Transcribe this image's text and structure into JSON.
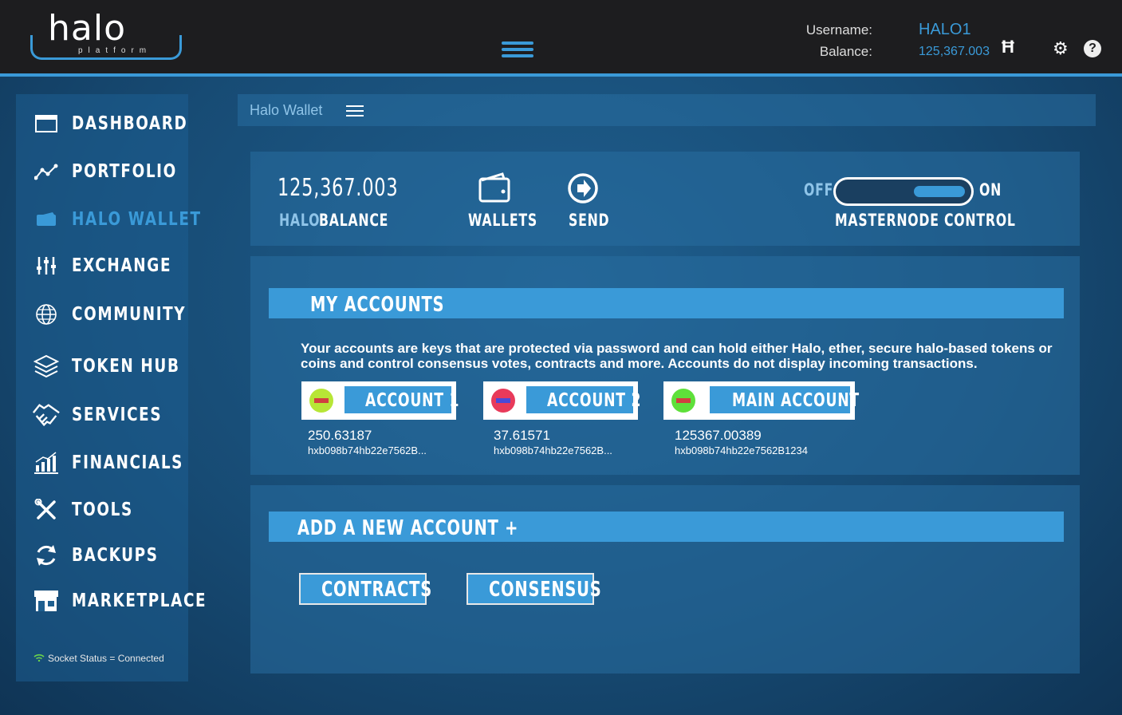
{
  "header": {
    "logo_word": "halo",
    "logo_sub": "platform",
    "username_label": "Username:",
    "balance_label": "Balance:",
    "username": "HALO1",
    "balance": "125,367.003",
    "currency_symbol": "Ħ"
  },
  "sidebar": {
    "items": [
      {
        "label": "DASHBOARD",
        "icon": "browser-window-icon"
      },
      {
        "label": "PORTFOLIO",
        "icon": "line-graph-icon"
      },
      {
        "label": "HALO WALLET",
        "icon": "wallet-icon"
      },
      {
        "label": "EXCHANGE",
        "icon": "sliders-icon"
      },
      {
        "label": "COMMUNITY",
        "icon": "globe-icon"
      },
      {
        "label": "TOKEN HUB",
        "icon": "layers-icon"
      },
      {
        "label": "SERVICES",
        "icon": "handshake-icon"
      },
      {
        "label": "FINANCIALS",
        "icon": "bar-chart-icon"
      },
      {
        "label": "TOOLS",
        "icon": "tools-icon"
      },
      {
        "label": "BACKUPS",
        "icon": "refresh-icon"
      },
      {
        "label": "MARKETPLACE",
        "icon": "store-icon"
      }
    ],
    "active": "HALO WALLET",
    "socket_status": "Socket Status = Connected"
  },
  "page": {
    "title": "Halo Wallet"
  },
  "summary": {
    "balance_value": "125,367.003",
    "currency": "HALO",
    "balance_label": "BALANCE",
    "wallets_label": "WALLETS",
    "send_label": "SEND",
    "off_label": "OFF",
    "on_label": "ON",
    "masternode_label": "MASTERNODE CONTROL",
    "masternode_on": true
  },
  "accounts": {
    "heading": "MY ACCOUNTS",
    "description": "Your accounts are keys that are protected via password and can hold either Halo, ether, secure halo-based tokens or coins and control consensus votes, contracts and more. Accounts do not display incoming transactions.",
    "items": [
      {
        "name": "ACCOUNT 1",
        "amount": "250.63187",
        "address": "hxb098b74hb22e7562B...",
        "dot_color": "#b7e636",
        "bar_color": "#d04040"
      },
      {
        "name": "ACCOUNT 2",
        "amount": "37.61571",
        "address": "hxb098b74hb22e7562B...",
        "dot_color": "#e83a5a",
        "bar_color": "#4a4ad8"
      },
      {
        "name": "MAIN ACCOUNT",
        "amount": "125367.00389",
        "address": "hxb098b74hb22e7562B1234",
        "dot_color": "#5ee03a",
        "bar_color": "#d04040"
      }
    ]
  },
  "new_account": {
    "heading": "ADD A NEW ACCOUNT +",
    "contracts_label": "CONTRACTS",
    "consensus_label": "CONSENSUS"
  },
  "colors": {
    "accent": "#3a9ad8",
    "topbar": "#1d1d1f"
  }
}
